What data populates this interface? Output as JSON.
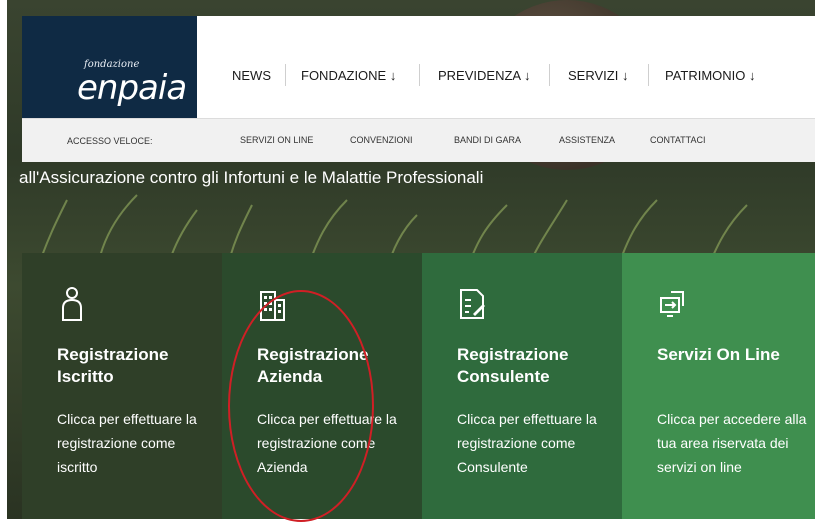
{
  "logo": {
    "small": "fondazione",
    "big": "enpaia"
  },
  "nav": {
    "items": [
      "NEWS",
      "FONDAZIONE ↓",
      "PREVIDENZA ↓",
      "SERVIZI ↓",
      "PATRIMONIO ↓"
    ]
  },
  "quick_access": {
    "label": "ACCESSO VELOCE:",
    "links": [
      "SERVIZI ON LINE",
      "CONVENZIONI",
      "BANDI DI GARA",
      "ASSISTENZA",
      "CONTATTACI"
    ]
  },
  "hero": {
    "subtitle": "all'Assicurazione contro gli Infortuni e le Malattie Professionali"
  },
  "cards": [
    {
      "title": "Registrazione Iscritto",
      "desc": "Clicca per effettuare la registrazione come iscritto",
      "icon": "person-icon",
      "color": "#2f3f28"
    },
    {
      "title": "Registrazione Azienda",
      "desc": "Clicca per effettuare la registrazione come Azienda",
      "icon": "building-icon",
      "color": "#2b4a2c"
    },
    {
      "title": "Registrazione Consulente",
      "desc": "Clicca per effettuare la registrazione come Consulente",
      "icon": "document-edit-icon",
      "color": "#2f6b3d"
    },
    {
      "title": "Servizi On Line",
      "desc": "Clicca per accedere alla tua area riservata dei servizi on line",
      "icon": "screen-arrow-icon",
      "color": "#3f8f4f"
    }
  ],
  "annotation": {
    "color": "#d01f25"
  }
}
